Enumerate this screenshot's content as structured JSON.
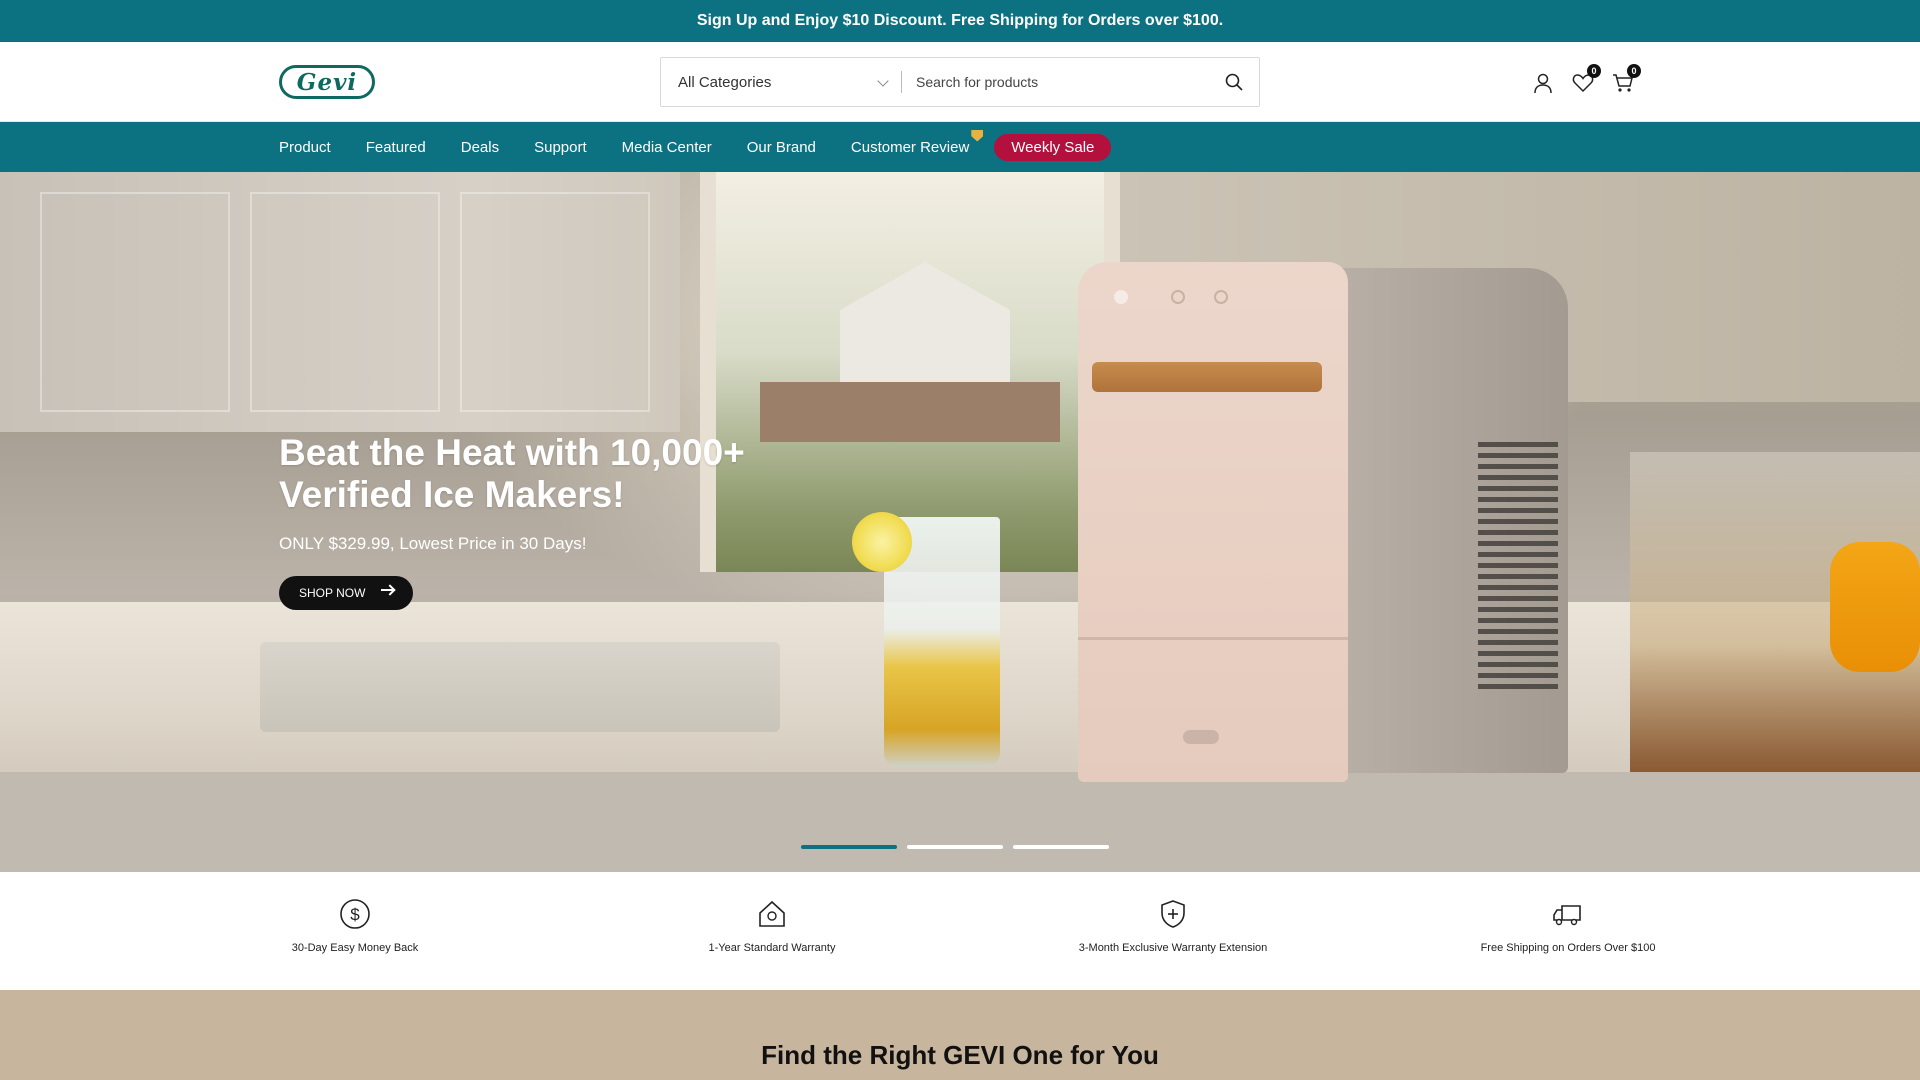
{
  "announcement": {
    "text": "Sign Up and Enjoy $10 Discount. Free Shipping for Orders over $100."
  },
  "header": {
    "logo": "Gevi",
    "search": {
      "category": "All Categories",
      "placeholder": "Search for products"
    },
    "icons": [
      "user-icon",
      "heart-icon",
      "cart-icon"
    ],
    "wishlist_count": "0",
    "cart_count": "0"
  },
  "nav": {
    "items": [
      "Product",
      "Featured",
      "Deals",
      "Support",
      "Media Center",
      "Our Brand",
      "Customer Review"
    ],
    "sale_label": "Weekly Sale"
  },
  "hero": {
    "title": "Beat the Heat with 10,000+ Verified Ice Makers!",
    "subtitle": "ONLY $329.99, Lowest Price in 30 Days!",
    "cta": "SHOP NOW",
    "slides": 3,
    "active_slide": 1
  },
  "features": [
    {
      "icon": "dollar-icon",
      "text": "30-Day Easy Money Back"
    },
    {
      "icon": "house-icon",
      "text": "1-Year Standard Warranty"
    },
    {
      "icon": "shield-plus-icon",
      "text": "3-Month Exclusive Warranty Extension"
    },
    {
      "icon": "truck-icon",
      "text": "Free Shipping on Orders Over $100"
    }
  ],
  "section": {
    "title": "Find the Right GEVI One for You"
  },
  "colors": {
    "teal": "#0c7180",
    "sale": "#b3103d",
    "section_bg": "#c7b59e"
  }
}
